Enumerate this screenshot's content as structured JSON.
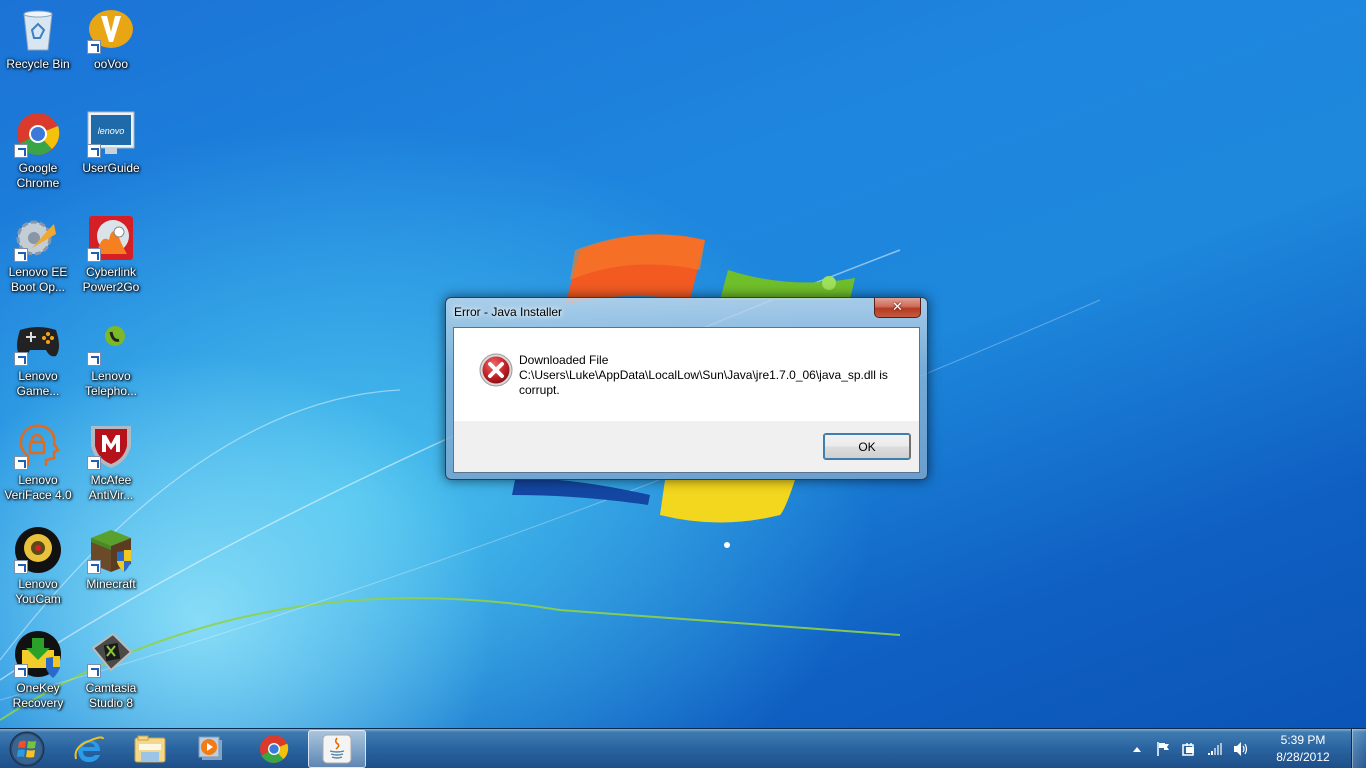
{
  "desktop": {
    "icons": [
      {
        "label": "Recycle Bin",
        "icon": "recycle-bin-icon",
        "shortcut": false
      },
      {
        "label": "ooVoo",
        "icon": "oovoo-icon",
        "shortcut": true
      },
      {
        "label": "Google Chrome",
        "icon": "chrome-icon",
        "shortcut": true
      },
      {
        "label": "UserGuide",
        "icon": "lenovo-userguide-icon",
        "shortcut": true
      },
      {
        "label": "Lenovo EE Boot Op...",
        "icon": "lenovo-ee-boot-icon",
        "shortcut": true
      },
      {
        "label": "Cyberlink Power2Go",
        "icon": "cyberlink-power2go-icon",
        "shortcut": true
      },
      {
        "label": "Lenovo Game...",
        "icon": "gamepad-icon",
        "shortcut": true
      },
      {
        "label": "Lenovo Telepho...",
        "icon": "telephone-icon",
        "shortcut": true
      },
      {
        "label": "Lenovo VeriFace 4.0",
        "icon": "veriface-icon",
        "shortcut": true
      },
      {
        "label": "McAfee AntiVir...",
        "icon": "mcafee-icon",
        "shortcut": true
      },
      {
        "label": "Lenovo YouCam",
        "icon": "webcam-icon",
        "shortcut": true
      },
      {
        "label": "Minecraft",
        "icon": "minecraft-icon",
        "shortcut": true
      },
      {
        "label": "OneKey Recovery",
        "icon": "onekey-recovery-icon",
        "shortcut": true
      },
      {
        "label": "Camtasia Studio 8",
        "icon": "camtasia-icon",
        "shortcut": true
      }
    ]
  },
  "dialog": {
    "title": "Error - Java Installer",
    "close_label": "✕",
    "icon": "error-icon",
    "message_line1": "Downloaded File",
    "message_line2": "C:\\Users\\Luke\\AppData\\LocalLow\\Sun\\Java\\jre1.7.0_06\\java_sp.dll is",
    "message_line3": "corrupt.",
    "ok_label": "OK"
  },
  "taskbar": {
    "start": "windows-start-icon",
    "items": [
      {
        "name": "internet-explorer",
        "icon": "internet-explorer-icon",
        "active": false
      },
      {
        "name": "windows-explorer",
        "icon": "folder-icon",
        "active": false
      },
      {
        "name": "windows-media-player",
        "icon": "media-player-icon",
        "active": false
      },
      {
        "name": "google-chrome",
        "icon": "chrome-icon",
        "active": false
      },
      {
        "name": "java-installer",
        "icon": "java-icon",
        "active": true
      }
    ],
    "tray": {
      "icons": [
        "show-hidden-icons-icon",
        "action-center-flag-icon",
        "power-plug-icon",
        "network-signal-icon",
        "volume-icon"
      ],
      "time": "5:39 PM",
      "date": "8/28/2012"
    }
  },
  "colors": {
    "error_red": "#c8262b",
    "wallpaper_blue": "#1e86de",
    "taskbar": "#2a64a0"
  }
}
